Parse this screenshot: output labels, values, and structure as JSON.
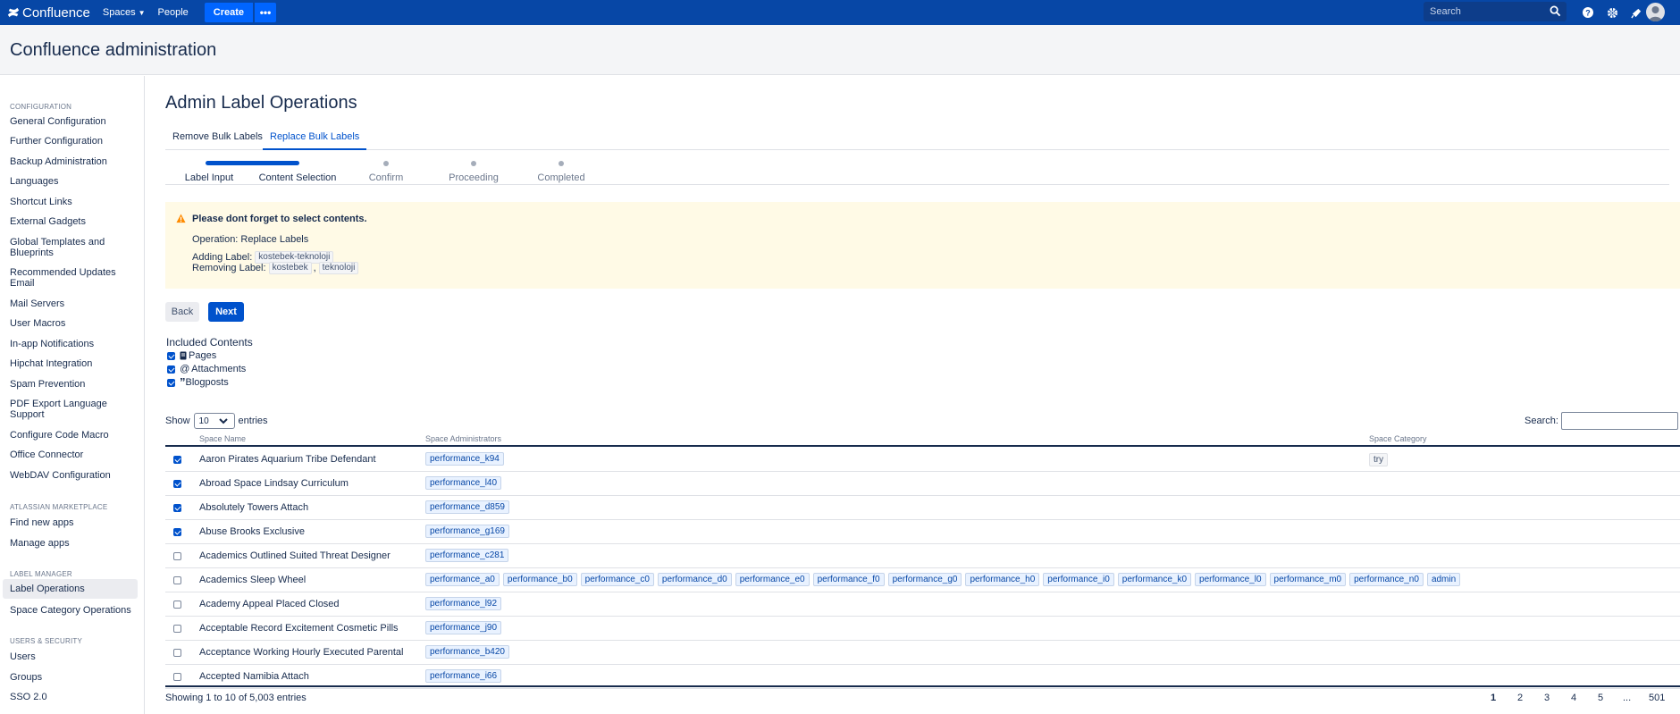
{
  "topbar": {
    "brand": "Confluence",
    "spaces": "Spaces",
    "people": "People",
    "create": "Create",
    "more": "•••",
    "search_placeholder": "Search"
  },
  "header": {
    "title": "Confluence administration"
  },
  "sidebar": {
    "sections": [
      {
        "label": "CONFIGURATION",
        "items": [
          "General Configuration",
          "Further Configuration",
          "Backup Administration",
          "Languages",
          "Shortcut Links",
          "External Gadgets",
          "Global Templates and Blueprints",
          "Recommended Updates Email",
          "Mail Servers",
          "User Macros",
          "In-app Notifications",
          "Hipchat Integration",
          "Spam Prevention",
          "PDF Export Language Support",
          "Configure Code Macro",
          "Office Connector",
          "WebDAV Configuration"
        ]
      },
      {
        "label": "ATLASSIAN MARKETPLACE",
        "items": [
          "Find new apps",
          "Manage apps"
        ]
      },
      {
        "label": "LABEL MANAGER",
        "items": [
          "Label Operations",
          "Space Category Operations"
        ]
      },
      {
        "label": "USERS & SECURITY",
        "items": [
          "Users",
          "Groups",
          "SSO 2.0"
        ]
      }
    ]
  },
  "main": {
    "title": "Admin Label Operations",
    "tabs": [
      "Remove Bulk Labels",
      "Replace Bulk Labels"
    ],
    "steps": [
      "Label Input",
      "Content Selection",
      "Confirm",
      "Proceeding",
      "Completed"
    ],
    "warning": {
      "title": "Please dont forget to select contents.",
      "operation": "Operation: Replace Labels",
      "adding_prefix": "Adding Label:",
      "adding": "kostebek-teknoloji",
      "removing_prefix": "Removing Label:",
      "removing": [
        "kostebek",
        "teknoloji"
      ],
      "separator": ","
    },
    "back": "Back",
    "next": "Next",
    "included_title": "Included Contents",
    "included": [
      "Pages",
      "Attachments",
      "Blogposts"
    ],
    "show_label": "Show",
    "entries_value": "10",
    "entries_label": "entries",
    "search_label": "Search:",
    "table": {
      "headers": [
        "Space Name",
        "Space Administrators",
        "Space Category"
      ],
      "rows": [
        {
          "checked": true,
          "name": "Aaron Pirates Aquarium Tribe Defendant",
          "admins": [
            "performance_k94"
          ],
          "category": "try"
        },
        {
          "checked": true,
          "name": "Abroad Space Lindsay Curriculum",
          "admins": [
            "performance_l40"
          ],
          "category": ""
        },
        {
          "checked": true,
          "name": "Absolutely Towers Attach",
          "admins": [
            "performance_d859"
          ],
          "category": ""
        },
        {
          "checked": true,
          "name": "Abuse Brooks Exclusive",
          "admins": [
            "performance_g169"
          ],
          "category": ""
        },
        {
          "checked": false,
          "name": "Academics Outlined Suited Threat Designer",
          "admins": [
            "performance_c281"
          ],
          "category": ""
        },
        {
          "checked": false,
          "name": "Academics Sleep Wheel",
          "admins": [
            "performance_a0",
            "performance_b0",
            "performance_c0",
            "performance_d0",
            "performance_e0",
            "performance_f0",
            "performance_g0",
            "performance_h0",
            "performance_i0",
            "performance_k0",
            "performance_l0",
            "performance_m0",
            "performance_n0",
            "admin"
          ],
          "category": ""
        },
        {
          "checked": false,
          "name": "Academy Appeal Placed Closed",
          "admins": [
            "performance_l92"
          ],
          "category": ""
        },
        {
          "checked": false,
          "name": "Acceptable Record Excitement Cosmetic Pills",
          "admins": [
            "performance_j90"
          ],
          "category": ""
        },
        {
          "checked": false,
          "name": "Acceptance Working Hourly Executed Parental",
          "admins": [
            "performance_b420"
          ],
          "category": ""
        },
        {
          "checked": false,
          "name": "Accepted Namibia Attach",
          "admins": [
            "performance_i66"
          ],
          "category": ""
        }
      ]
    },
    "showing": "Showing 1 to 10 of 5,003 entries",
    "pagination": [
      "1",
      "2",
      "3",
      "4",
      "5",
      "...",
      "501"
    ]
  }
}
